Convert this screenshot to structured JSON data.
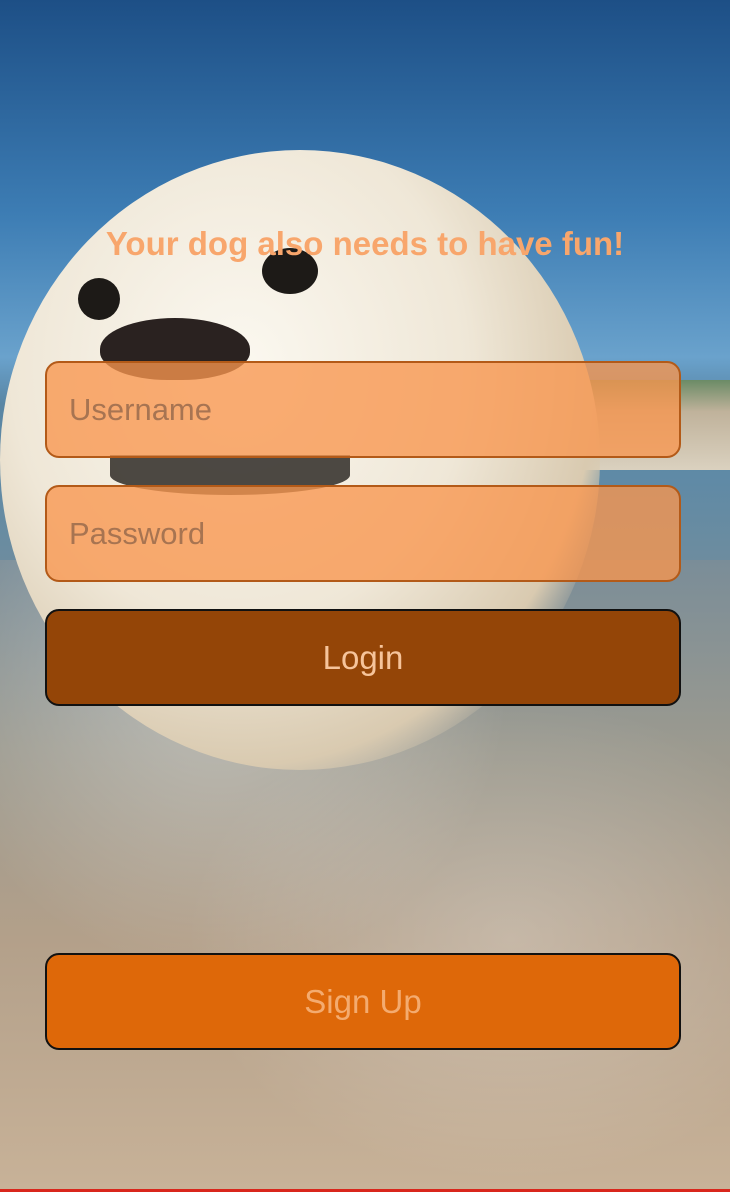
{
  "header": {
    "tagline": "Your dog also needs to have fun!"
  },
  "login_form": {
    "username": {
      "value": "",
      "placeholder": "Username"
    },
    "password": {
      "value": "",
      "placeholder": "Password"
    },
    "login_label": "Login",
    "signup_label": "Sign Up"
  },
  "colors": {
    "tagline": "#f8a66c",
    "field_bg": "#f8964e",
    "field_border": "#b35a18",
    "login_bg": "#944507",
    "login_text": "#f6c49b",
    "signup_bg": "#de6809",
    "signup_text": "#f4ab6f"
  }
}
